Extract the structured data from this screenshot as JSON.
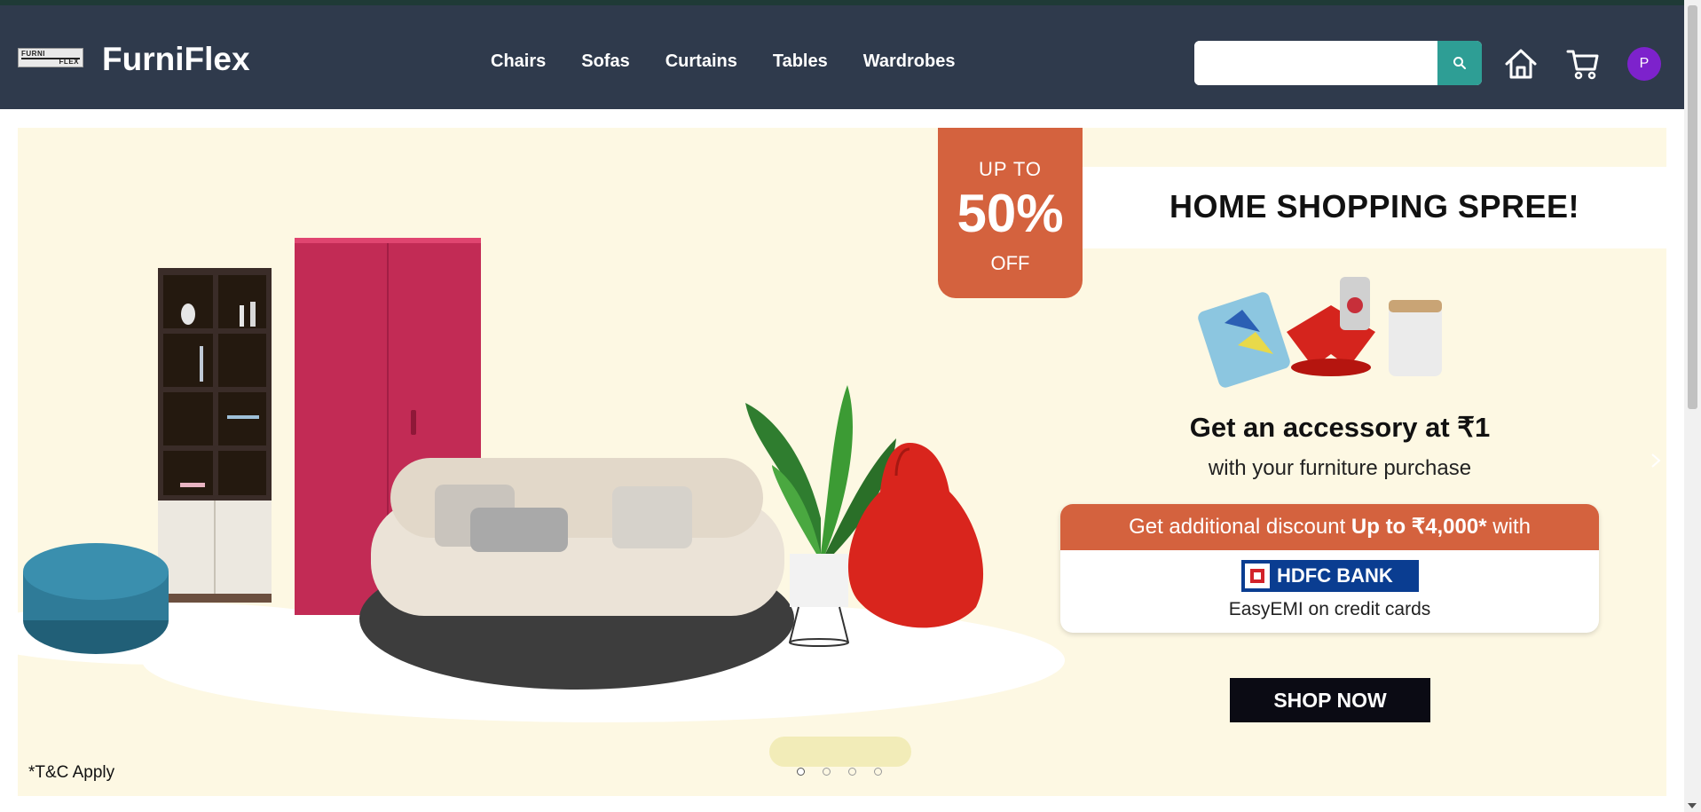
{
  "header": {
    "logo_line1": "FURNI",
    "logo_line2": "FLEX",
    "brand": "FurniFlex",
    "nav": [
      "Chairs",
      "Sofas",
      "Curtains",
      "Tables",
      "Wardrobes"
    ],
    "search_value": "",
    "search_placeholder": "",
    "avatar_initial": "P",
    "icons": [
      "search-icon",
      "home-icon",
      "cart-icon"
    ]
  },
  "banner": {
    "badge_upto": "UP TO",
    "badge_percent": "50%",
    "badge_off": "OFF",
    "headline": "HOME SHOPPING SPREE!",
    "accessory_title": "Get an accessory at ₹1",
    "accessory_sub": "with your furniture purchase",
    "offer_prefix": "Get additional discount ",
    "offer_bold": "Up to ₹4,000*",
    "offer_suffix": " with",
    "bank_name": "HDFC BANK",
    "emi_text": "EasyEMI on credit cards",
    "cta": "SHOP NOW",
    "tnc": "*T&C Apply",
    "slide_count": 4,
    "active_slide": 1
  },
  "colors": {
    "navbar": "#2f3a4c",
    "search_button": "#2e9e95",
    "avatar": "#7d22cc",
    "banner_bg": "#fdf8e3",
    "accent_orange": "#d4623e"
  }
}
